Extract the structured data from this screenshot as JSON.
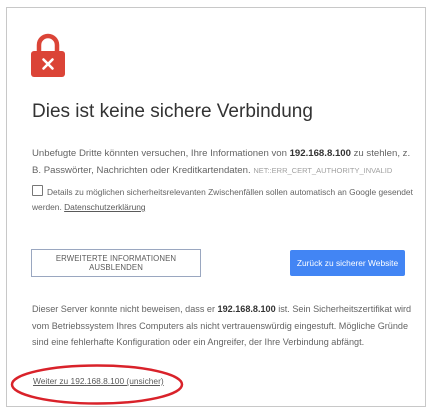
{
  "page": {
    "title": "Dies ist keine sichere Verbindung",
    "intro_before": "Unbefugte Dritte könnten versuchen, Ihre Informationen von ",
    "host": "192.168.8.100",
    "intro_after": " zu stehlen, z. B. Passwörter, Nachrichten oder Kreditkartendaten.",
    "error_code": "NET::ERR_CERT_AUTHORITY_INVALID"
  },
  "report": {
    "checked": false,
    "text": "Details zu möglichen sicherheitsrelevanten Zwischenfällen sollen automatisch an Google gesendet werden.",
    "privacy_link": "Datenschutzerklärung"
  },
  "buttons": {
    "hide_advanced": "ERWEITERTE INFORMATIONEN AUSBLENDEN",
    "back_to_safety": "Zurück zu sicherer Website"
  },
  "details": {
    "before": "Dieser Server konnte nicht beweisen, dass er ",
    "host": "192.168.8.100",
    "after": " ist. Sein Sicherheitszertifikat wird vom Betriebssystem Ihres Computers als nicht vertrauenswürdig eingestuft. Mögliche Gründe sind eine fehlerhafte Konfiguration oder ein Angreifer, der Ihre Verbindung abfängt.",
    "proceed_link": "Weiter zu 192.168.8.100 (unsicher)"
  },
  "colors": {
    "lock": "#db4437",
    "primary_button": "#4285f4",
    "annotation_circle": "#d9222a"
  },
  "icons": {
    "lock": "lock-icon",
    "checkbox": "checkbox-icon"
  }
}
